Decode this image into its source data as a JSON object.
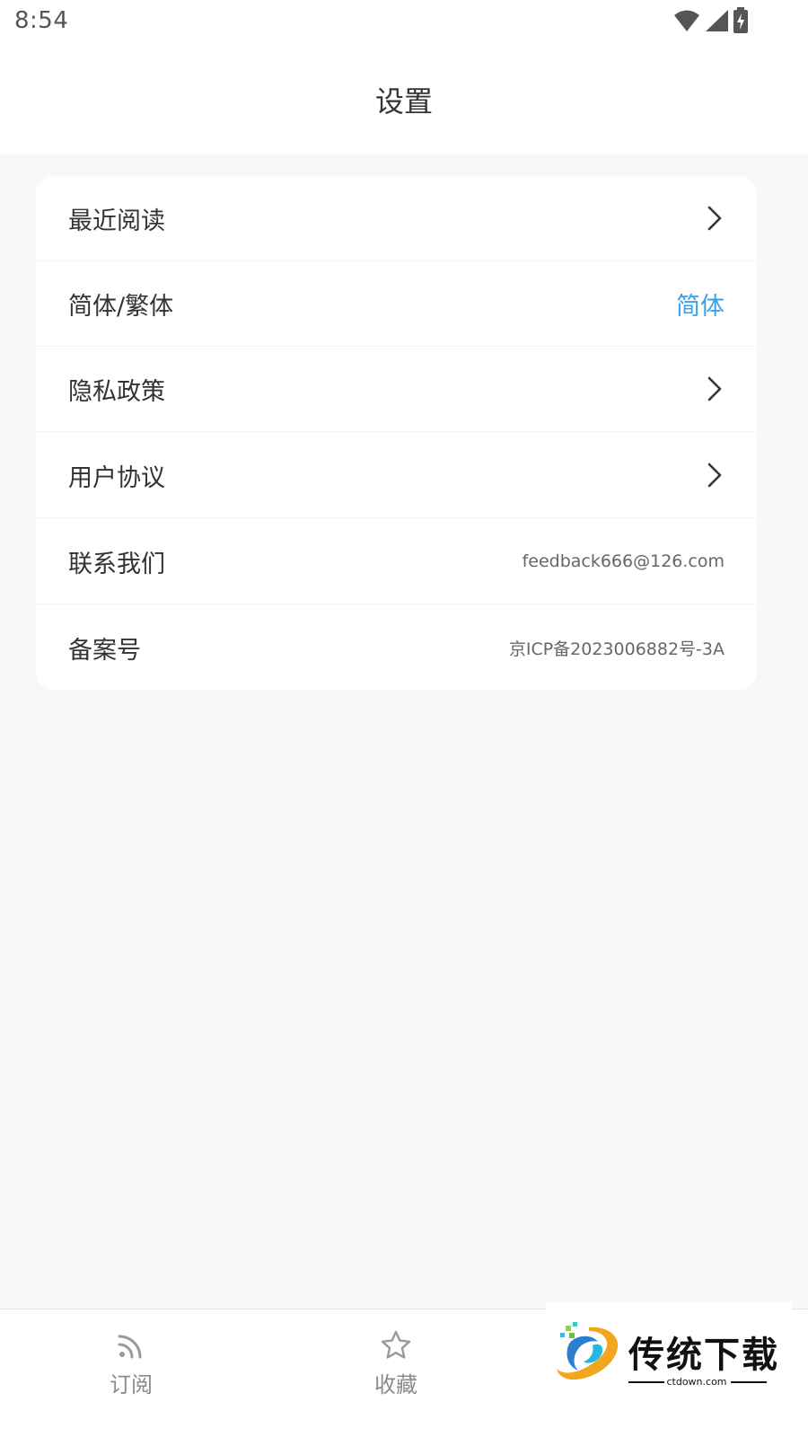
{
  "status_bar": {
    "time": "8:54",
    "icons": [
      "wifi-icon",
      "cellular-signal-icon",
      "battery-charging-icon"
    ]
  },
  "header": {
    "title": "设置"
  },
  "settings": {
    "items": [
      {
        "label": "最近阅读",
        "trailing": "chevron-right-icon"
      },
      {
        "label": "简体/繁体",
        "value": "简体"
      },
      {
        "label": "隐私政策",
        "trailing": "chevron-right-icon"
      },
      {
        "label": "用户协议",
        "trailing": "chevron-right-icon"
      },
      {
        "label": "联系我们",
        "value": "feedback666@126.com"
      },
      {
        "label": "备案号",
        "value": "京ICP备2023006882号-3A"
      }
    ]
  },
  "tab_bar": {
    "tabs": [
      {
        "label": "订阅",
        "icon": "rss-feed-icon"
      },
      {
        "label": "收藏",
        "icon": "star-icon"
      }
    ]
  },
  "watermark": {
    "text": "传统下载",
    "url": "ctdown.com"
  },
  "colors": {
    "accent": "#3aa0e8",
    "background": "#f8f8f8",
    "card": "#ffffff",
    "text_primary": "#333333",
    "text_secondary": "#666666",
    "tab_inactive": "#8a8a8a"
  }
}
